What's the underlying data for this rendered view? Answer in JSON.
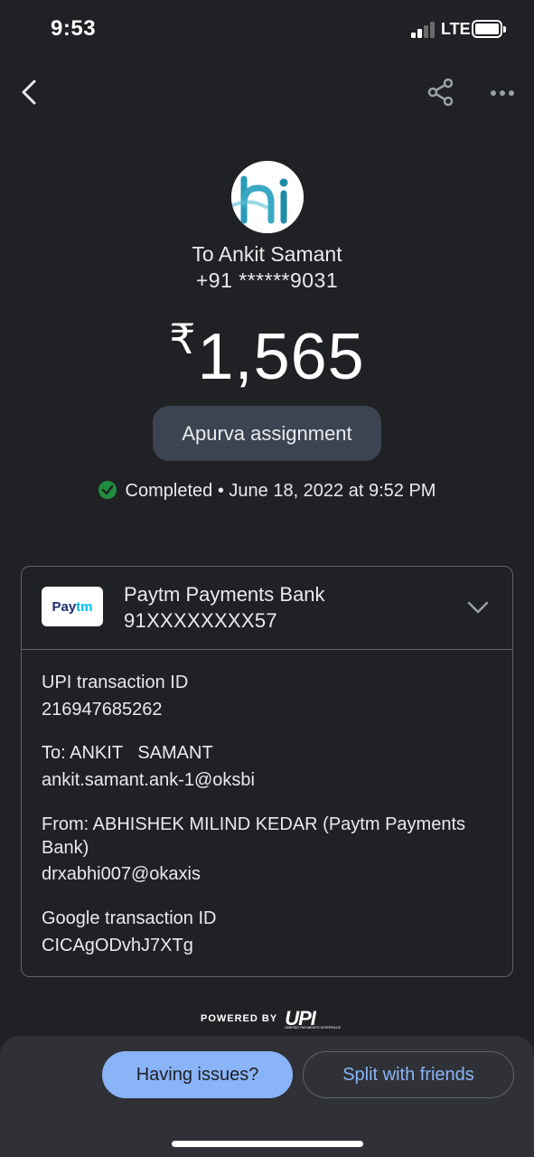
{
  "status_bar": {
    "time": "9:53",
    "network": "LTE"
  },
  "nav": {
    "back_icon": "chevron-left-icon",
    "share_icon": "share-icon",
    "more_icon": "more-horizontal-icon"
  },
  "payment": {
    "recipient": "To Ankit Samant",
    "phone": "+91 ******9031",
    "currency_symbol": "₹",
    "amount": "1,565",
    "note": "Apurva assignment",
    "status": "Completed",
    "separator": "•",
    "datetime": "June 18, 2022 at 9:52 PM",
    "status_color": "#1e8e3e"
  },
  "bank": {
    "logo_part1": "Pay",
    "logo_part2": "tm",
    "name": "Paytm Payments Bank",
    "account": "91XXXXXXXX57"
  },
  "details": {
    "upi_id_label": "UPI transaction ID",
    "upi_id_value": "216947685262",
    "to_label": "To: ANKIT   SAMANT",
    "to_value": "ankit.samant.ank-1@oksbi",
    "from_label": "From: ABHISHEK MILIND KEDAR (Paytm Payments Bank)",
    "from_value": "drxabhi007@okaxis",
    "google_id_label": "Google transaction ID",
    "google_id_value": "CICAgODvhJ7XTg"
  },
  "footer": {
    "powered_by": "POWERED BY",
    "upi_logo": "UPI",
    "upi_subtitle": "UNIFIED PAYMENTS INTERFACE"
  },
  "actions": {
    "issues_label": "Having issues?",
    "split_label": "Split with friends"
  },
  "colors": {
    "background": "#202124",
    "accent": "#8ab4f8",
    "pill": "#3c4452"
  }
}
